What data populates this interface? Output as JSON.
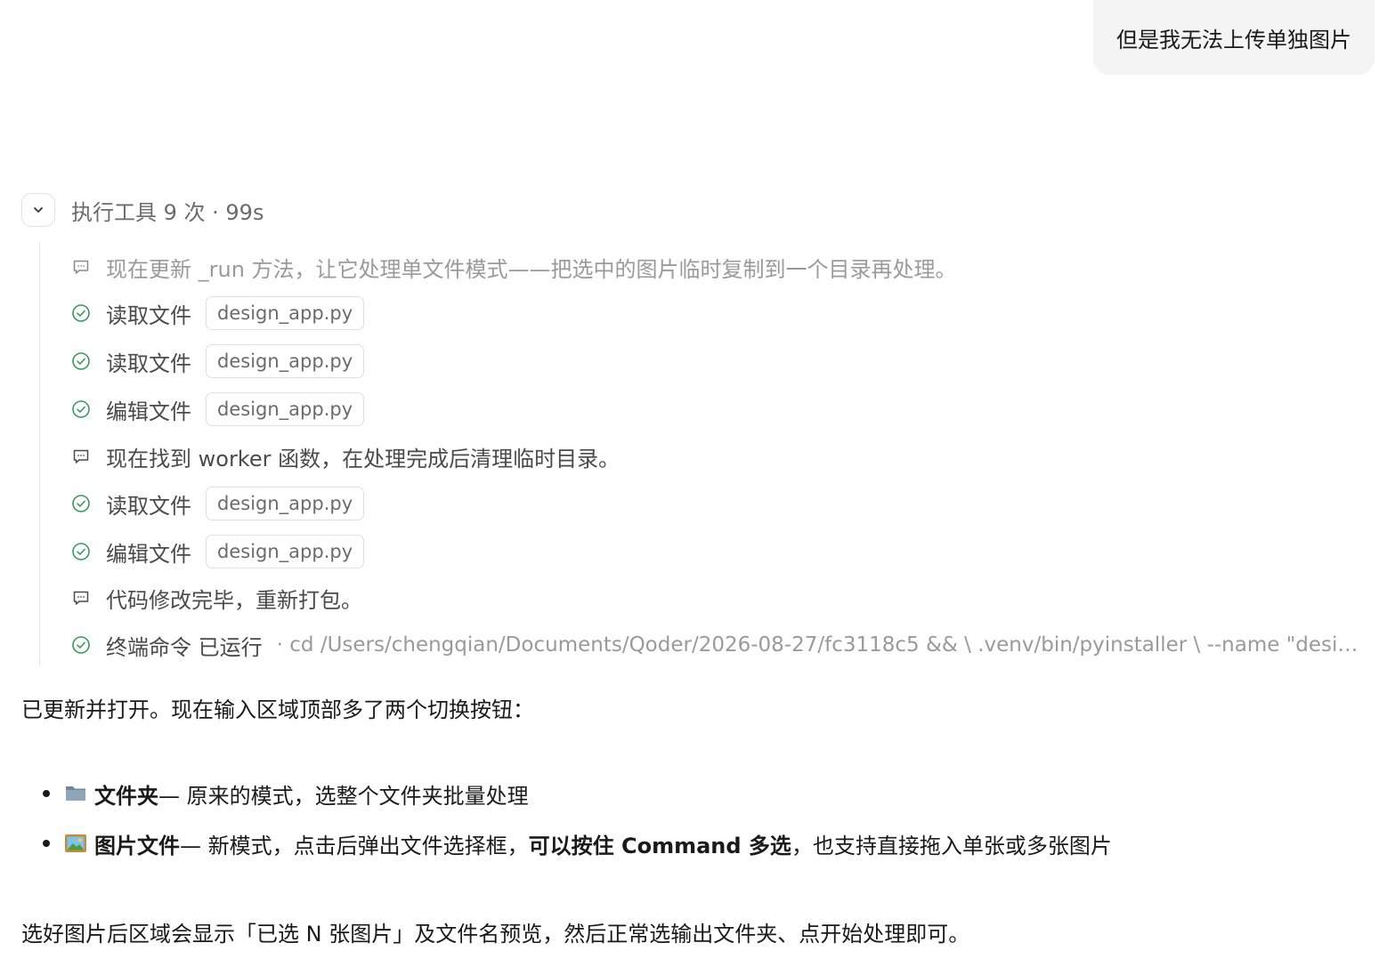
{
  "user_message": "但是我无法上传单独图片",
  "tool_group": {
    "summary": "执行工具 9 次 · 99s",
    "steps": [
      {
        "type": "note",
        "text": "现在更新 _run 方法，让它处理单文件模式——把选中的图片临时复制到一个目录再处理。",
        "icon": "message-icon"
      },
      {
        "type": "tool",
        "label": "读取文件",
        "file": "design_app.py",
        "icon": "check-circle-icon"
      },
      {
        "type": "tool",
        "label": "读取文件",
        "file": "design_app.py",
        "icon": "check-circle-icon"
      },
      {
        "type": "tool",
        "label": "编辑文件",
        "file": "design_app.py",
        "icon": "check-circle-icon"
      },
      {
        "type": "note",
        "text": "现在找到 worker 函数，在处理完成后清理临时目录。",
        "icon": "message-icon"
      },
      {
        "type": "tool",
        "label": "读取文件",
        "file": "design_app.py",
        "icon": "check-circle-icon"
      },
      {
        "type": "tool",
        "label": "编辑文件",
        "file": "design_app.py",
        "icon": "check-circle-icon"
      },
      {
        "type": "note",
        "text": "代码修改完毕，重新打包。",
        "icon": "message-icon"
      },
      {
        "type": "tool",
        "label": "终端命令 已运行",
        "command": "· cd /Users/chengqian/Documents/Qoder/2026-08-27/fc3118c5 && \\ .venv/bin/pyinstaller \\ --name \"design_app\" --windowed",
        "icon": "check-circle-icon"
      }
    ]
  },
  "reply": {
    "intro": "已更新并打开。现在输入区域顶部多了两个切换按钮：",
    "bullets": [
      {
        "icon": "folder-icon",
        "bold": "文件夹",
        "text": " — 原来的模式，选整个文件夹批量处理"
      },
      {
        "icon": "picture-icon",
        "bold": "图片文件",
        "text": " — 新模式，点击后弹出文件选择框，",
        "bold2": "可以按住 Command 多选",
        "text2": "，也支持直接拖入单张或多张图片"
      }
    ],
    "outro": "选好图片后区域会显示「已选 N 张图片」及文件名预览，然后正常选输出文件夹、点开始处理即可。"
  },
  "colors": {
    "check": "#3a9a5b",
    "muted": "#9a9a9a",
    "bubble_bg": "#f4f4f4"
  }
}
